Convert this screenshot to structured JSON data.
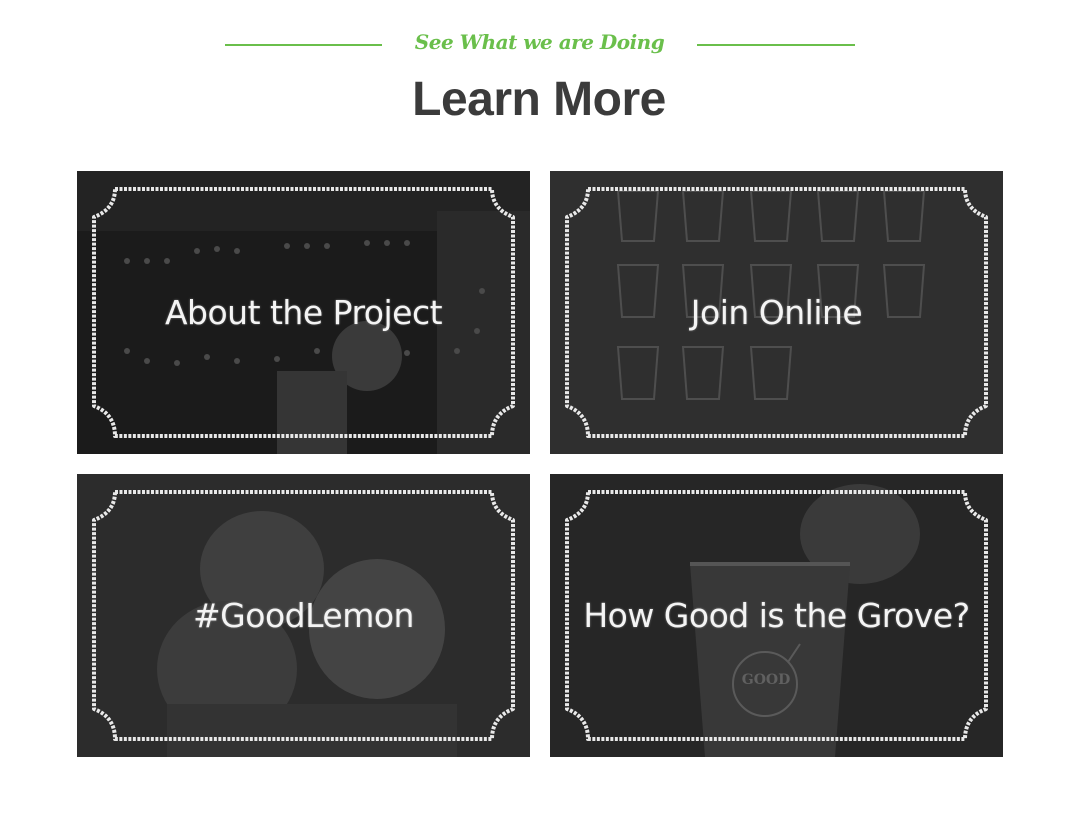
{
  "section": {
    "tagline": "See What we are Doing",
    "title": "Learn More"
  },
  "cards": [
    {
      "label": "About the Project",
      "image": "open-sign-photo"
    },
    {
      "label": "Join Online",
      "image": "chalk-cups-drawing"
    },
    {
      "label": "#GoodLemon",
      "image": "lemons-photo"
    },
    {
      "label": "How Good is the Grove?",
      "image": "lemonade-cup-photo",
      "cup_print": "GOOD"
    }
  ],
  "colors": {
    "accent": "#6abf4b",
    "heading": "#3b3b3b",
    "chalk": "#f4f4f4"
  }
}
